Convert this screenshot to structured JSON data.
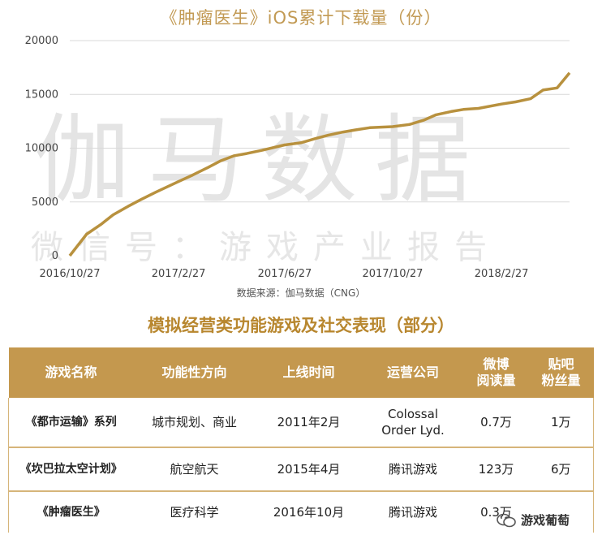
{
  "chart_title": "《肿瘤医生》iOS累计下载量（份）",
  "watermark": {
    "main": "伽马数据",
    "sub": "微信号：游戏产业报告"
  },
  "source": "数据来源：伽马数据（CNG）",
  "chart_data": {
    "type": "line",
    "title": "《肿瘤医生》iOS累计下载量（份）",
    "xlabel": "",
    "ylabel": "",
    "ylim": [
      0,
      20000
    ],
    "yticks": [
      "0",
      "5000",
      "10000",
      "15000",
      "20000"
    ],
    "xticks": [
      "2016/10/27",
      "2017/2/27",
      "2017/6/27",
      "2017/10/27",
      "2018/2/27"
    ],
    "grid": true,
    "color": "#b8913e",
    "series": [
      {
        "x": [
          "2016/10/27",
          "2016/11/15",
          "2016/12/1",
          "2016/12/15",
          "2017/1/1",
          "2017/1/15",
          "2017/2/1",
          "2017/2/27",
          "2017/3/15",
          "2017/4/1",
          "2017/4/15",
          "2017/5/1",
          "2017/5/15",
          "2017/6/1",
          "2017/6/27",
          "2017/7/15",
          "2017/8/1",
          "2017/8/15",
          "2017/9/1",
          "2017/9/15",
          "2017/10/1",
          "2017/10/27",
          "2017/11/15",
          "2017/12/1",
          "2017/12/15",
          "2018/1/1",
          "2018/1/15",
          "2018/2/1",
          "2018/2/27",
          "2018/3/15",
          "2018/4/1",
          "2018/4/15",
          "2018/5/1",
          "2018/5/15"
        ],
        "values": [
          0,
          2000,
          2900,
          3800,
          4600,
          5200,
          5900,
          6900,
          7500,
          8200,
          8800,
          9300,
          9500,
          9800,
          10300,
          10500,
          10900,
          11200,
          11500,
          11700,
          11900,
          12000,
          12200,
          12600,
          13100,
          13400,
          13600,
          13700,
          14100,
          14300,
          14600,
          15400,
          15600,
          17000
        ]
      }
    ]
  },
  "table": {
    "title": "模拟经营类功能游戏及社交表现（部分）",
    "headers": [
      "游戏名称",
      "功能性方向",
      "上线时间",
      "运营公司",
      "微博\n阅读量",
      "贴吧\n粉丝量"
    ],
    "rows": [
      [
        "《都市运输》系列",
        "城市规划、商业",
        "2011年2月",
        "Colossal\nOrder Lyd.",
        "0.7万",
        "1万"
      ],
      [
        "《坎巴拉太空计划》",
        "航空航天",
        "2015年4月",
        "腾讯游戏",
        "123万",
        "6万"
      ],
      [
        "《肿瘤医生》",
        "医疗科学",
        "2016年10月",
        "腾讯游戏",
        "0.3万",
        ""
      ]
    ]
  },
  "wechat_label": "游戏葡萄"
}
